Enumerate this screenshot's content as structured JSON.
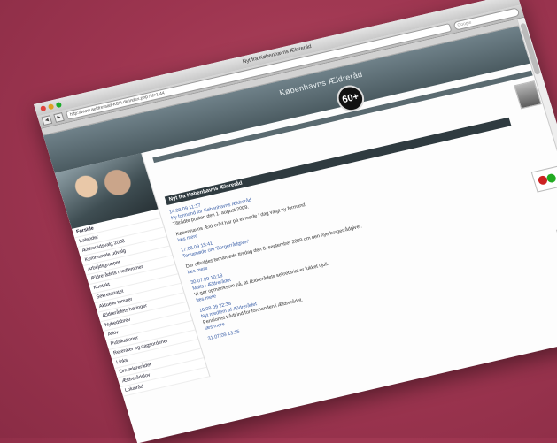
{
  "window": {
    "title": "Nyt fra Københavns Ældreråd"
  },
  "toolbar": {
    "url": "http://www.aeldreraad-KBH.dk/index.php?id=1 44",
    "search_placeholder": "Google"
  },
  "banner": {
    "title": "Københavns Ældreråd",
    "badge": "60+"
  },
  "sidebar": {
    "items": [
      "Forside",
      "Kalender",
      "Ældrerådsvalg 2008",
      "Kommunale udvalg",
      "Arbejdsgrupper",
      "Ældrerådets medlemmer",
      "Kontakt",
      "Sekretariatet",
      "Aktuelle temaer",
      "Ældrerådets høringer",
      "Nyhedsbrev",
      "Arkiv",
      "Publikationer",
      "Referater og dagsordener",
      "Links",
      "Om ældrerådet",
      "Ældrerådslov",
      "Lokalråd"
    ]
  },
  "main": {
    "section_title": "Nyt fra Københavns Ældreråd",
    "news": [
      {
        "date": "14.08.09 11:17",
        "title": "Ny formand for Københavns Ældreråd",
        "text": "Tiltrådte posten den 1. august 2009.",
        "more": ""
      },
      {
        "date": "",
        "title": "",
        "text": "Københavns Ældreråd har på et møde i dag valgt ny formand.",
        "more": "læs mere"
      },
      {
        "date": "17.08.09 15:41",
        "title": "Temamøde om 'Borgerrådgiver'",
        "text": "Der afholdes temamøde i Ældrerådet den 28. september.",
        "more": ""
      },
      {
        "date": "",
        "title": "",
        "text": "Der afholdes temamøde tirsdag den 8. september 2009 om den nye borgerrådgiver.",
        "more": "læs mere"
      },
      {
        "date": "30.07.09 10:18",
        "title": "Mails i Ældrerådet",
        "text": "Vi gør opmærksom på, at Ældrerådets sekretariat er lukket i juli.",
        "more": "læs mere"
      },
      {
        "date": "16.08.09 22:38",
        "title": "Nyt medlem af Ældrerådet",
        "text": "Pensionist trådt ind for formanden i Ældrerådet.",
        "more": "læs mere"
      },
      {
        "date": "31.07.09 13:15",
        "title": "",
        "text": "",
        "more": ""
      }
    ]
  }
}
